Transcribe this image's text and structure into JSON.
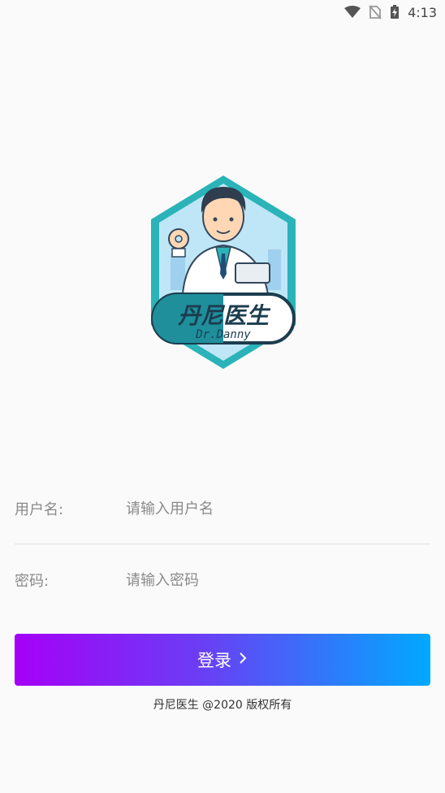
{
  "status_bar": {
    "time": "4:13",
    "icons": [
      "wifi-icon",
      "no-sim-icon",
      "battery-charging-icon"
    ]
  },
  "logo": {
    "title": "丹尼医生",
    "subtitle": "Dr.Danny",
    "colors": {
      "frame": "#2ab3b8",
      "sky": "#bfe6f6",
      "pill_left": "#1f8f9c",
      "pill_right": "#ffffff"
    }
  },
  "form": {
    "username_label": "用户名:",
    "username_placeholder": "请输入用户名",
    "password_label": "密码:",
    "password_placeholder": "请输入密码"
  },
  "login_button": {
    "label": "登录",
    "gradient": [
      "#a500f7",
      "#00a9ff"
    ]
  },
  "footer": {
    "copyright": "丹尼医生 @2020 版权所有"
  }
}
